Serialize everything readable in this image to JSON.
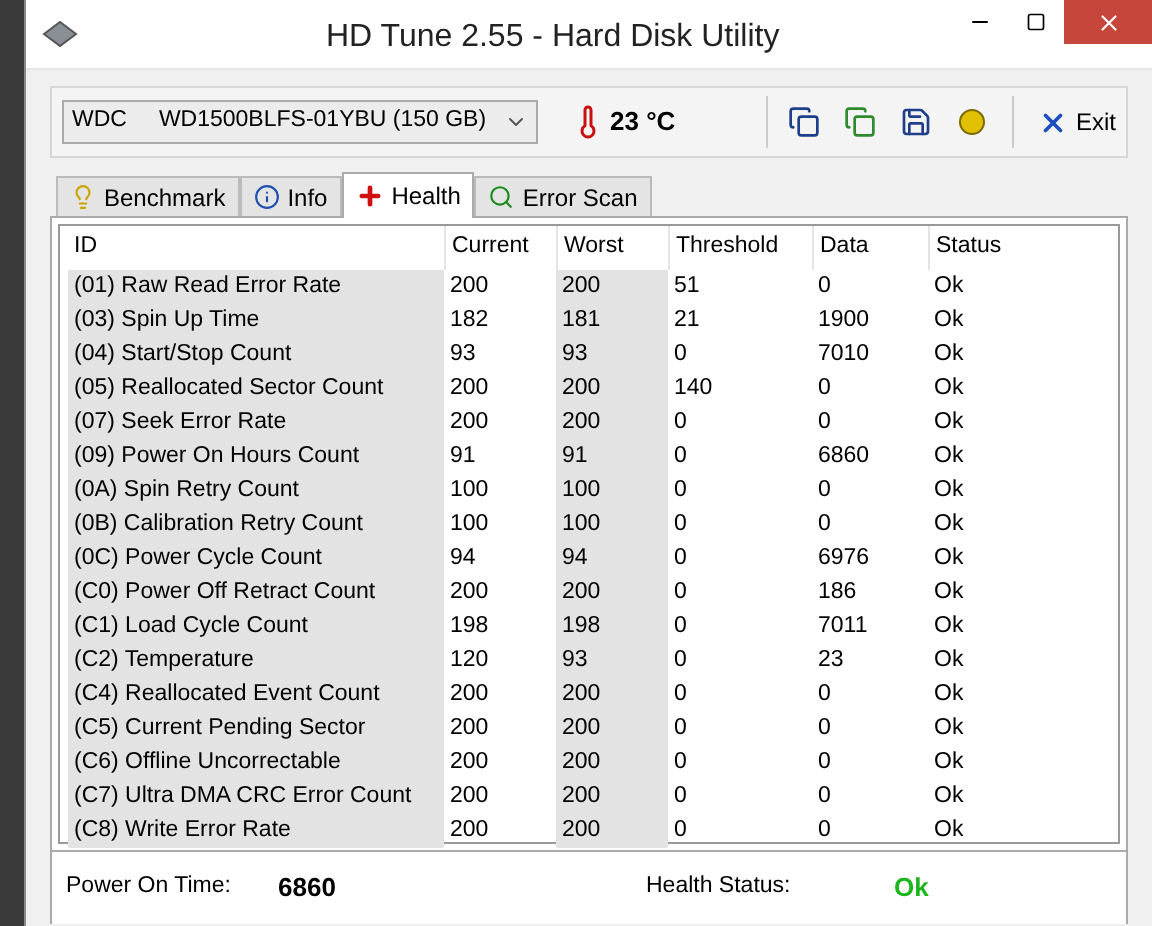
{
  "window": {
    "title": "HD Tune 2.55 - Hard Disk Utility"
  },
  "drive": {
    "value": "WDC     WD1500BLFS-01YBU (150 GB)"
  },
  "temperature": "23 °C",
  "toolbar": {
    "exit_label": "Exit"
  },
  "tabs": [
    {
      "label": "Benchmark",
      "kind": "benchmark",
      "selected": false
    },
    {
      "label": "Info",
      "kind": "info",
      "selected": false
    },
    {
      "label": "Health",
      "kind": "health",
      "selected": true
    },
    {
      "label": "Error Scan",
      "kind": "scan",
      "selected": false
    }
  ],
  "table": {
    "columns": [
      "ID",
      "Current",
      "Worst",
      "Threshold",
      "Data",
      "Status"
    ],
    "rows": [
      [
        "(01) Raw Read Error Rate",
        "200",
        "200",
        "51",
        "0",
        "Ok"
      ],
      [
        "(03) Spin Up Time",
        "182",
        "181",
        "21",
        "1900",
        "Ok"
      ],
      [
        "(04) Start/Stop Count",
        "93",
        "93",
        "0",
        "7010",
        "Ok"
      ],
      [
        "(05) Reallocated Sector Count",
        "200",
        "200",
        "140",
        "0",
        "Ok"
      ],
      [
        "(07) Seek Error Rate",
        "200",
        "200",
        "0",
        "0",
        "Ok"
      ],
      [
        "(09) Power On Hours Count",
        "91",
        "91",
        "0",
        "6860",
        "Ok"
      ],
      [
        "(0A) Spin Retry Count",
        "100",
        "100",
        "0",
        "0",
        "Ok"
      ],
      [
        "(0B) Calibration Retry Count",
        "100",
        "100",
        "0",
        "0",
        "Ok"
      ],
      [
        "(0C) Power Cycle Count",
        "94",
        "94",
        "0",
        "6976",
        "Ok"
      ],
      [
        "(C0) Power Off Retract Count",
        "200",
        "200",
        "0",
        "186",
        "Ok"
      ],
      [
        "(C1) Load Cycle Count",
        "198",
        "198",
        "0",
        "7011",
        "Ok"
      ],
      [
        "(C2) Temperature",
        "120",
        "93",
        "0",
        "23",
        "Ok"
      ],
      [
        "(C4) Reallocated Event Count",
        "200",
        "200",
        "0",
        "0",
        "Ok"
      ],
      [
        "(C5) Current Pending Sector",
        "200",
        "200",
        "0",
        "0",
        "Ok"
      ],
      [
        "(C6) Offline Uncorrectable",
        "200",
        "200",
        "0",
        "0",
        "Ok"
      ],
      [
        "(C7) Ultra DMA CRC Error Count",
        "200",
        "200",
        "0",
        "0",
        "Ok"
      ],
      [
        "(C8) Write Error Rate",
        "200",
        "200",
        "0",
        "0",
        "Ok"
      ]
    ]
  },
  "footer": {
    "power_on_label": "Power On Time:",
    "power_on_value": "6860",
    "health_label": "Health Status:",
    "health_value": "Ok"
  }
}
